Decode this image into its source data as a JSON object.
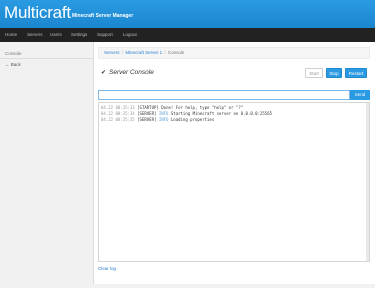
{
  "header": {
    "brand": "Multicraft",
    "subtitle": "Minecraft Server Manager",
    "accent": "#1e8fd8"
  },
  "nav": {
    "items": [
      {
        "label": "Home"
      },
      {
        "label": "Servers"
      },
      {
        "label": "Users"
      },
      {
        "label": "Settings"
      },
      {
        "label": "Support"
      },
      {
        "label": "Logout"
      }
    ]
  },
  "sidebar": {
    "title": "Console",
    "back_icon": "back-arrow-icon",
    "back_label": "Back"
  },
  "breadcrumb": {
    "items": [
      {
        "label": "Servers"
      },
      {
        "label": "Minecraft Server 1"
      },
      {
        "label": "Console"
      }
    ],
    "separator": "/"
  },
  "main": {
    "title_icon": "check-icon",
    "title": "Server Console",
    "buttons": {
      "start": "Start",
      "stop": "Stop",
      "restart": "Restart"
    },
    "command": {
      "value": "",
      "placeholder": "",
      "send_label": "Send"
    },
    "console_lines": [
      {
        "ts": "04.22 08:35:33",
        "tag": "[STARTUP]",
        "level": "",
        "msg": "Done! For help, type \"help\" or \"?\""
      },
      {
        "ts": "04.22 08:35:34",
        "tag": "[SERVER]",
        "level": "INFO",
        "msg": "Starting Minecraft server on 0.0.0.0:25565"
      },
      {
        "ts": "04.22 08:35:35",
        "tag": "[SERVER]",
        "level": "INFO",
        "msg": "Loading properties"
      }
    ],
    "clear_log": "Clear log"
  }
}
